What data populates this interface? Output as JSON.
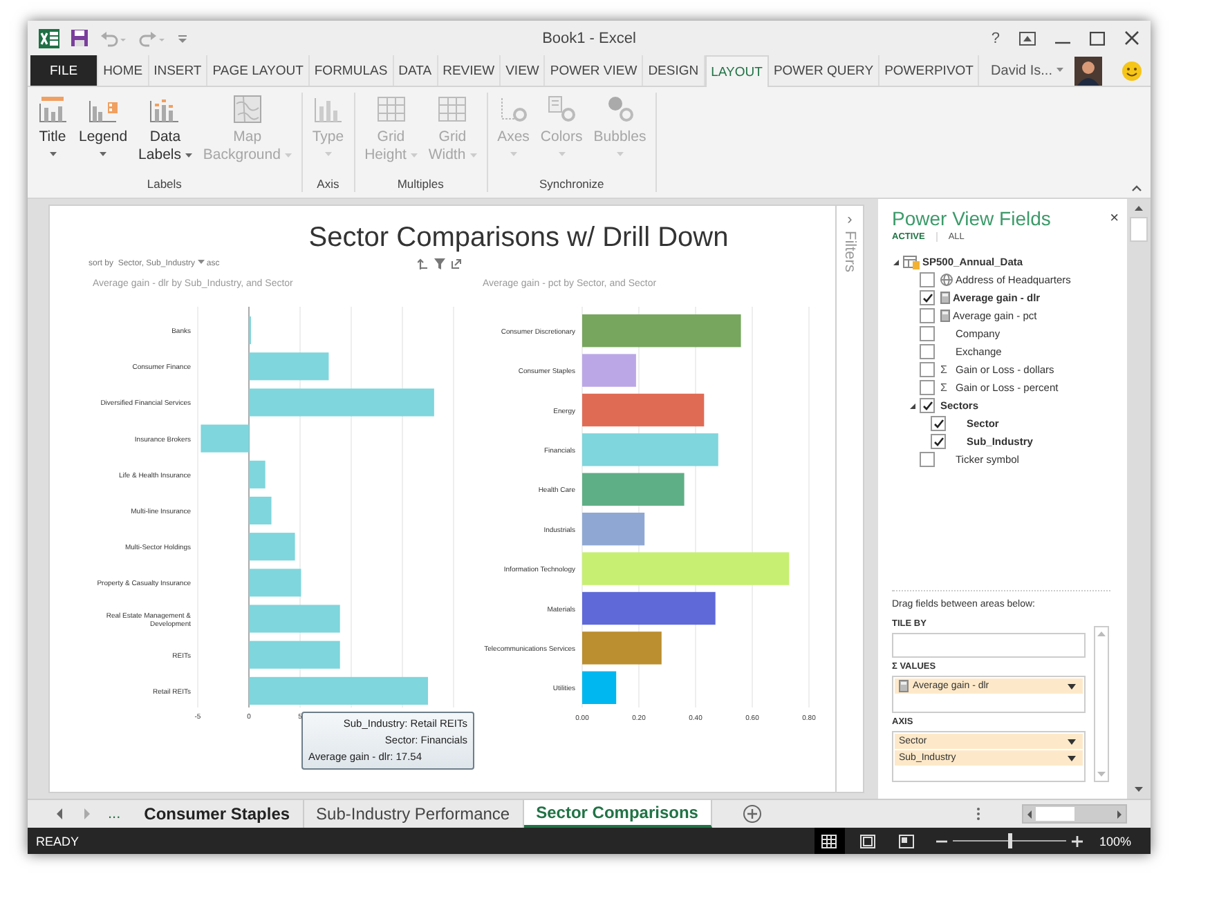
{
  "window": {
    "title": "Book1 - Excel",
    "help": "?"
  },
  "ribbon_tabs": [
    {
      "label": "FILE",
      "kind": "file",
      "selected": false
    },
    {
      "label": "HOME",
      "kind": "tab",
      "selected": false
    },
    {
      "label": "INSERT",
      "kind": "tab",
      "selected": false
    },
    {
      "label": "PAGE LAYOUT",
      "kind": "tab",
      "selected": false
    },
    {
      "label": "FORMULAS",
      "kind": "tab",
      "selected": false
    },
    {
      "label": "DATA",
      "kind": "tab",
      "selected": false
    },
    {
      "label": "REVIEW",
      "kind": "tab",
      "selected": false
    },
    {
      "label": "VIEW",
      "kind": "tab",
      "selected": false
    },
    {
      "label": "POWER VIEW",
      "kind": "tab",
      "selected": false
    },
    {
      "label": "DESIGN",
      "kind": "tab",
      "selected": false
    },
    {
      "label": "LAYOUT",
      "kind": "tab",
      "selected": true
    },
    {
      "label": "POWER QUERY",
      "kind": "tab",
      "selected": false
    },
    {
      "label": "POWERPIVOT",
      "kind": "tab",
      "selected": false
    }
  ],
  "account": {
    "name": "David Is..."
  },
  "ribbon": {
    "groups": [
      {
        "label": "Labels",
        "buttons": [
          {
            "lines": [
              "Title"
            ],
            "kind": "title",
            "disabled": false
          },
          {
            "lines": [
              "Legend"
            ],
            "kind": "legend",
            "disabled": false
          },
          {
            "lines": [
              "Data",
              "Labels"
            ],
            "kind": "data_labels",
            "disabled": false
          },
          {
            "lines": [
              "Map",
              "Background"
            ],
            "kind": "map",
            "disabled": true
          }
        ]
      },
      {
        "label": "Axis",
        "buttons": [
          {
            "lines": [
              "Type"
            ],
            "kind": "type",
            "disabled": true
          }
        ]
      },
      {
        "label": "Multiples",
        "buttons": [
          {
            "lines": [
              "Grid",
              "Height"
            ],
            "kind": "grid",
            "disabled": true
          },
          {
            "lines": [
              "Grid",
              "Width"
            ],
            "kind": "grid",
            "disabled": true
          }
        ]
      },
      {
        "label": "Synchronize",
        "buttons": [
          {
            "lines": [
              "Axes"
            ],
            "kind": "axes",
            "disabled": true
          },
          {
            "lines": [
              "Colors"
            ],
            "kind": "colors",
            "disabled": true
          },
          {
            "lines": [
              "Bubbles"
            ],
            "kind": "bubbles",
            "disabled": true
          }
        ]
      }
    ]
  },
  "canvas": {
    "title": "Sector Comparisons w/ Drill Down",
    "sort": {
      "prefix": "sort by",
      "field": "Sector, Sub_Industry",
      "order": "asc"
    },
    "charts": [
      {
        "chart_data": {
          "type": "bar",
          "orientation": "horizontal",
          "title": "Average gain - dlr by Sub_Industry, and Sector",
          "categories": [
            "Banks",
            "Consumer Finance",
            "Diversified Financial Services",
            "Insurance Brokers",
            "Life & Health Insurance",
            "Multi-line Insurance",
            "Multi-Sector Holdings",
            "Property & Casualty Insurance",
            "Real Estate Management & Development",
            "REITs",
            "Retail REITs"
          ],
          "series": [
            {
              "color": "#7fd6dc",
              "values": [
                0.2,
                7.8,
                18.1,
                -4.7,
                1.6,
                2.2,
                4.5,
                5.1,
                8.9,
                8.9,
                17.5
              ]
            }
          ],
          "xlim": [
            -5,
            20
          ],
          "xticks": [
            -5,
            0,
            5
          ],
          "grid": true
        }
      },
      {
        "chart_data": {
          "type": "bar",
          "orientation": "horizontal",
          "title": "Average gain - pct by Sector, and Sector",
          "categories": [
            "Consumer Discretionary",
            "Consumer Staples",
            "Energy",
            "Financials",
            "Health Care",
            "Industrials",
            "Information Technology",
            "Materials",
            "Telecommunications Services",
            "Utilities"
          ],
          "series": [
            {
              "color": "#77a65f",
              "values": [
                0.56,
                null,
                null,
                null,
                null,
                null,
                null,
                null,
                null,
                null
              ]
            },
            {
              "color": "#bba7e6",
              "values": [
                null,
                0.19,
                null,
                null,
                null,
                null,
                null,
                null,
                null,
                null
              ]
            },
            {
              "color": "#e06b55",
              "values": [
                null,
                null,
                0.43,
                null,
                null,
                null,
                null,
                null,
                null,
                null
              ]
            },
            {
              "color": "#7fd6dc",
              "values": [
                null,
                null,
                null,
                0.48,
                null,
                null,
                null,
                null,
                null,
                null
              ]
            },
            {
              "color": "#5faf86",
              "values": [
                null,
                null,
                null,
                null,
                0.36,
                null,
                null,
                null,
                null,
                null
              ]
            },
            {
              "color": "#8fa8d3",
              "values": [
                null,
                null,
                null,
                null,
                null,
                0.22,
                null,
                null,
                null,
                null
              ]
            },
            {
              "color": "#c7ef72",
              "values": [
                null,
                null,
                null,
                null,
                null,
                null,
                0.73,
                null,
                null,
                null
              ]
            },
            {
              "color": "#5f69d8",
              "values": [
                null,
                null,
                null,
                null,
                null,
                null,
                null,
                0.47,
                null,
                null
              ]
            },
            {
              "color": "#bb8e2f",
              "values": [
                null,
                null,
                null,
                null,
                null,
                null,
                null,
                null,
                0.28,
                null
              ]
            },
            {
              "color": "#00b7ef",
              "values": [
                null,
                null,
                null,
                null,
                null,
                null,
                null,
                null,
                null,
                0.12
              ]
            }
          ],
          "grid": true,
          "xlim": [
            0,
            0.8
          ],
          "xticks": [
            {
              "value": 0,
              "label": "0.00"
            },
            {
              "value": 0.2,
              "label": "0.20"
            },
            {
              "value": 0.4,
              "label": "0.40"
            },
            {
              "value": 0.6,
              "label": "0.60"
            },
            {
              "value": 0.8,
              "label": "0.80"
            }
          ]
        }
      }
    ],
    "tooltip": {
      "lines": [
        "Sub_Industry: Retail REITs",
        "Sector: Financials",
        "Average gain - dlr: 17.54"
      ]
    }
  },
  "filters_pane": {
    "toggle": "›",
    "label": "Filters"
  },
  "fields_pane": {
    "title": "Power View Fields",
    "close": "×",
    "tabs": [
      {
        "label": "ACTIVE",
        "selected": true
      },
      {
        "label": "ALL",
        "selected": false
      }
    ],
    "tree": [
      {
        "label": "SP500_Annual_Data",
        "kind": "table",
        "expanded": true,
        "children": [
          {
            "label": "Address of Headquarters",
            "kind": "geography",
            "checked": false
          },
          {
            "label": "Average gain - dlr",
            "kind": "measure",
            "checked": true
          },
          {
            "label": "Average gain - pct",
            "kind": "measure",
            "checked": false
          },
          {
            "label": "Company",
            "kind": "field",
            "checked": false
          },
          {
            "label": "Exchange",
            "kind": "field",
            "checked": false
          },
          {
            "label": "Gain or Loss - dollars",
            "kind": "sum",
            "symbol": "Σ",
            "checked": false
          },
          {
            "label": "Gain or Loss - percent",
            "kind": "sum",
            "symbol": "Σ",
            "checked": false
          },
          {
            "label": "Sectors",
            "kind": "hierarchy",
            "expanded": true,
            "checked": true,
            "children": [
              {
                "label": "Sector",
                "kind": "field",
                "checked": true
              },
              {
                "label": "Sub_Industry",
                "kind": "field",
                "checked": true
              }
            ]
          },
          {
            "label": "Ticker symbol",
            "kind": "field",
            "checked": false
          }
        ]
      }
    ],
    "hint": "Drag fields between areas below:",
    "areas": [
      {
        "label": "TILE BY"
      },
      {
        "label": "Σ VALUES",
        "items": [
          {
            "label": "Average gain - dlr",
            "kind": "measure"
          }
        ]
      },
      {
        "label": "AXIS",
        "items": [
          {
            "label": "Sector",
            "kind": "field"
          },
          {
            "label": "Sub_Industry",
            "kind": "field"
          }
        ]
      }
    ]
  },
  "sheet_tabs": {
    "more": "...",
    "tabs": [
      {
        "label": "Consumer Staples",
        "bold": true,
        "selected": false
      },
      {
        "label": "Sub-Industry Performance",
        "bold": false,
        "selected": false
      },
      {
        "label": "Sector Comparisons",
        "bold": false,
        "selected": true
      }
    ]
  },
  "status_bar": {
    "status": "READY",
    "views": [
      {
        "kind": "normal",
        "selected": true
      },
      {
        "kind": "page_layout",
        "selected": false
      },
      {
        "kind": "page_break",
        "selected": false
      }
    ],
    "zoom": {
      "level": 0.5,
      "reading": "100%"
    }
  }
}
